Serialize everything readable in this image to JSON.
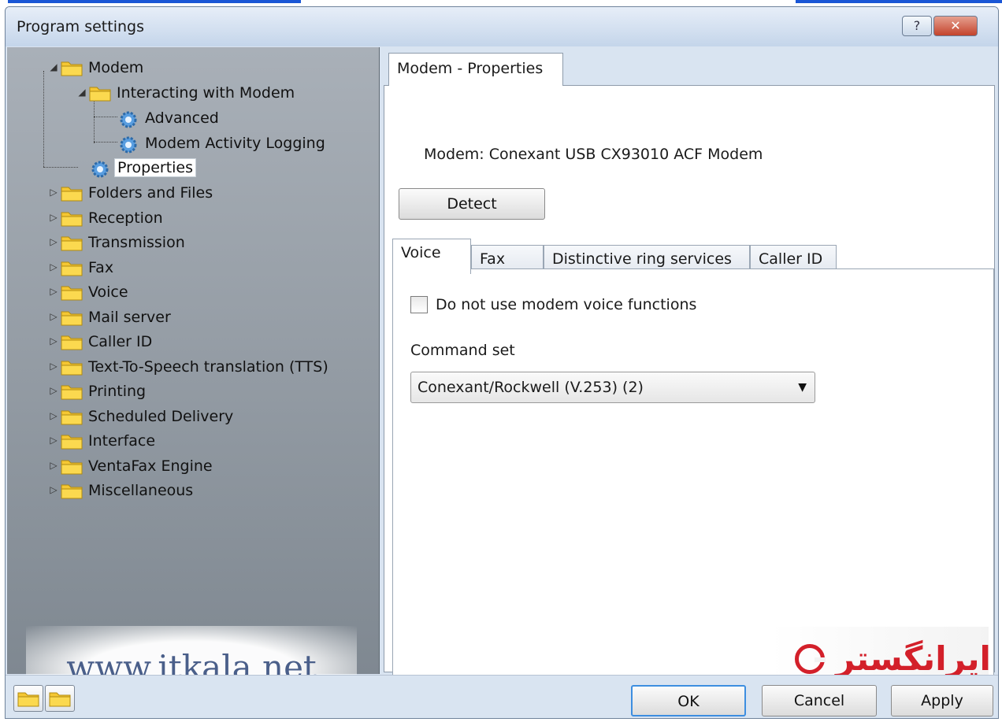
{
  "window": {
    "title": "Program settings",
    "help_label": "?",
    "close_label": "✕"
  },
  "tree": {
    "items": [
      {
        "label": "Modem",
        "expander": "◢"
      },
      {
        "label": "Interacting with Modem",
        "expander": "◢"
      },
      {
        "label": "Advanced"
      },
      {
        "label": "Modem Activity Logging"
      },
      {
        "label": "Properties"
      },
      {
        "label": "Folders and Files",
        "expander": "▷"
      },
      {
        "label": "Reception",
        "expander": "▷"
      },
      {
        "label": "Transmission",
        "expander": "▷"
      },
      {
        "label": "Fax",
        "expander": "▷"
      },
      {
        "label": "Voice",
        "expander": "▷"
      },
      {
        "label": "Mail server",
        "expander": "▷"
      },
      {
        "label": "Caller ID",
        "expander": "▷"
      },
      {
        "label": "Text-To-Speech translation (TTS)",
        "expander": "▷"
      },
      {
        "label": "Printing",
        "expander": "▷"
      },
      {
        "label": "Scheduled Delivery",
        "expander": "▷"
      },
      {
        "label": "Interface",
        "expander": "▷"
      },
      {
        "label": "VentaFax Engine",
        "expander": "▷"
      },
      {
        "label": "Miscellaneous",
        "expander": "▷"
      }
    ]
  },
  "watermark": {
    "text": "www.itkala.net"
  },
  "panel": {
    "tab_label": "Modem - Properties",
    "modem_line": "Modem: Conexant USB CX93010 ACF Modem",
    "detect_label": "Detect",
    "subtabs": [
      {
        "label": "Voice"
      },
      {
        "label": "Fax"
      },
      {
        "label": "Distinctive ring services"
      },
      {
        "label": "Caller ID"
      }
    ],
    "voice": {
      "checkbox_label": "Do not use modem voice functions",
      "command_set_label": "Command set",
      "command_set_value": "Conexant/Rockwell (V.253) (2)"
    }
  },
  "brand": {
    "text": "ایرانگستر"
  },
  "buttons": {
    "ok": "OK",
    "cancel": "Cancel",
    "apply": "Apply"
  },
  "colors": {
    "brand_red": "#d3202a",
    "tree_bg": "#8e969f",
    "ok_border": "#3d8ee0"
  }
}
